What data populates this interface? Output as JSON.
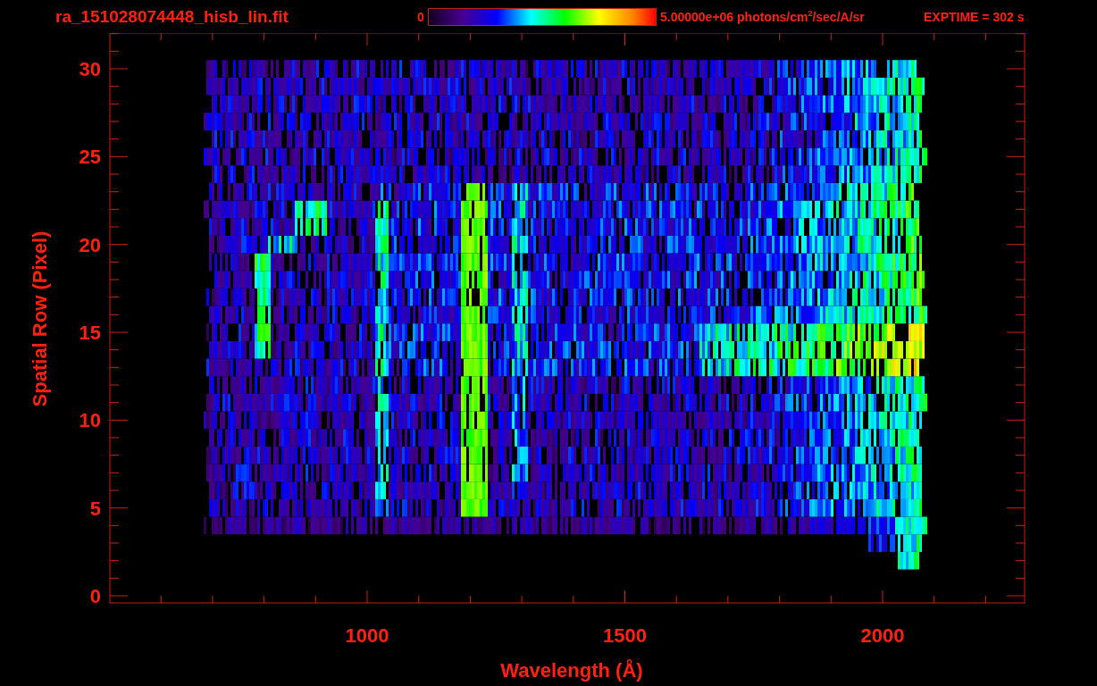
{
  "title": "ra_151028074448_hisb_lin.fit",
  "colorbar": {
    "min_label": "0",
    "max_label": "5.00000e+06 photons/cm$^{2}$/sec/A/sr"
  },
  "exptime": "EXPTIME = 302 s",
  "plot": {
    "xlabel": "Wavelength (Å)",
    "ylabel": "Spatial Row (Pixel)",
    "xticks": [
      "1000",
      "1500",
      "2000"
    ],
    "yticks": [
      "30",
      "25",
      "20",
      "15",
      "10",
      "5",
      "0"
    ]
  }
}
